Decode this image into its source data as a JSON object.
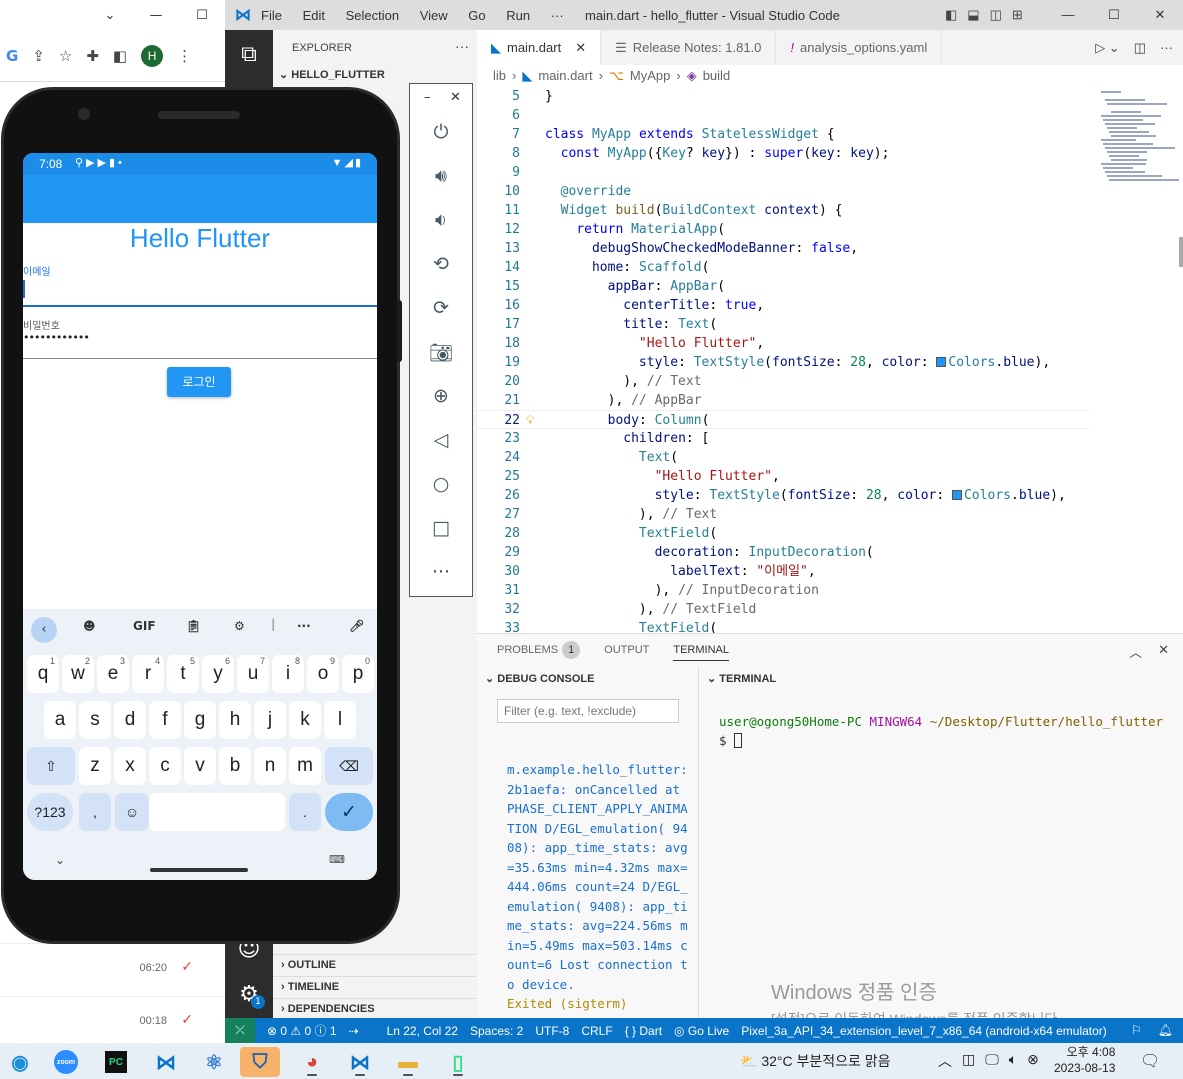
{
  "browser": {
    "window_controls": [
      "⌄",
      "—",
      "☐"
    ],
    "avatar_letter": "H",
    "chat_times": [
      "06:20",
      "00:18"
    ]
  },
  "vscode": {
    "title": "main.dart - hello_flutter - Visual Studio Code",
    "menu": [
      "File",
      "Edit",
      "Selection",
      "View",
      "Go",
      "Run",
      "···"
    ],
    "explorer_header": "EXPLORER",
    "project": "HELLO_FLUTTER",
    "sections": [
      "OUTLINE",
      "TIMELINE",
      "DEPENDENCIES"
    ],
    "tabs": [
      {
        "label": "main.dart",
        "icon": "dart-icon",
        "active": true
      },
      {
        "label": "Release Notes: 1.81.0",
        "icon": "notes-icon",
        "active": false
      },
      {
        "label": "analysis_options.yaml",
        "icon": "yaml-icon",
        "active": false
      }
    ],
    "breadcrumbs": [
      "lib",
      "main.dart",
      "MyApp",
      "build"
    ],
    "settings_badge": "1",
    "code_lines": [
      {
        "n": "5",
        "html": "}"
      },
      {
        "n": "6",
        "html": ""
      },
      {
        "n": "7",
        "html": "<span class='kw'>class</span> <span class='ty'>MyApp</span> <span class='kw'>extends</span> <span class='ty'>StatelessWidget</span> {"
      },
      {
        "n": "8",
        "html": "  <span class='kw'>const</span> <span class='ty'>MyApp</span>({<span class='ty'>Key</span>? <span class='pr'>key</span>}) : <span class='kw'>super</span>(<span class='pr'>key</span>: <span class='pr'>key</span>);"
      },
      {
        "n": "9",
        "html": ""
      },
      {
        "n": "10",
        "html": "  <span class='ty'>@override</span>"
      },
      {
        "n": "11",
        "html": "  <span class='ty'>Widget</span> <span class='fn'>build</span>(<span class='ty'>BuildContext</span> <span class='pr'>context</span>) {"
      },
      {
        "n": "12",
        "html": "    <span class='kw'>return</span> <span class='ty'>MaterialApp</span>("
      },
      {
        "n": "13",
        "html": "      <span class='pr'>debugShowCheckedModeBanner</span>: <span class='kw'>false</span>,"
      },
      {
        "n": "14",
        "html": "      <span class='pr'>home</span>: <span class='ty'>Scaffold</span>("
      },
      {
        "n": "15",
        "html": "        <span class='pr'>appBar</span>: <span class='ty'>AppBar</span>("
      },
      {
        "n": "16",
        "html": "          <span class='pr'>centerTitle</span>: <span class='kw'>true</span>,"
      },
      {
        "n": "17",
        "html": "          <span class='pr'>title</span>: <span class='ty'>Text</span>("
      },
      {
        "n": "18",
        "html": "            <span class='st'>\"Hello Flutter\"</span>,"
      },
      {
        "n": "19",
        "html": "            <span class='pr'>style</span>: <span class='ty'>TextStyle</span>(<span class='pr'>fontSize</span>: <span class='nm'>28</span>, <span class='pr'>color</span>: <span class='swatch'></span><span class='ty'>Colors</span>.<span class='pr'>blue</span>),"
      },
      {
        "n": "20",
        "html": "          ), <span class='cm'>// Text</span>"
      },
      {
        "n": "21",
        "html": "        ), <span class='cm'>// AppBar</span>"
      },
      {
        "n": "22",
        "html": "        <span class='pr'>body</span>: <span class='ty'>Column</span>(",
        "current": true
      },
      {
        "n": "23",
        "html": "          <span class='pr'>children</span>: ["
      },
      {
        "n": "24",
        "html": "            <span class='ty'>Text</span>("
      },
      {
        "n": "25",
        "html": "              <span class='st'>\"Hello Flutter\"</span>,"
      },
      {
        "n": "26",
        "html": "              <span class='pr'>style</span>: <span class='ty'>TextStyle</span>(<span class='pr'>fontSize</span>: <span class='nm'>28</span>, <span class='pr'>color</span>: <span class='swatch'></span><span class='ty'>Colors</span>.<span class='pr'>blue</span>),"
      },
      {
        "n": "27",
        "html": "            ), <span class='cm'>// Text</span>"
      },
      {
        "n": "28",
        "html": "            <span class='ty'>TextField</span>("
      },
      {
        "n": "29",
        "html": "              <span class='pr'>decoration</span>: <span class='ty'>InputDecoration</span>("
      },
      {
        "n": "30",
        "html": "                <span class='pr'>labelText</span>: <span class='st'>\"이메일\"</span>,"
      },
      {
        "n": "31",
        "html": "              ), <span class='cm'>// InputDecoration</span>"
      },
      {
        "n": "32",
        "html": "            ), <span class='cm'>// TextField</span>"
      },
      {
        "n": "33",
        "html": "            <span class='ty'>TextField</span>("
      }
    ],
    "panel": {
      "tabs": [
        "PROBLEMS",
        "OUTPUT",
        "TERMINAL"
      ],
      "problems_count": "1",
      "debug_console_title": "DEBUG CONSOLE",
      "filter_placeholder": "Filter (e.g. text, !exclude)",
      "log_text": "m.example.hello_flutter:2b1aefa: onCancelled at PHASE_CLIENT_APPLY_ANIMATION D/EGL_emulation( 9408): app_time_stats: avg=35.63ms min=4.32ms max=444.06ms count=24 D/EGL_emulation( 9408): app_time_stats: avg=224.56ms min=5.49ms max=503.14ms count=6 Lost connection to device.",
      "log_exit": "Exited (sigterm)",
      "terminal_title": "TERMINAL",
      "term_user": "user@ogong50Home-PC",
      "term_shell": "MINGW64",
      "term_path": "~/Desktop/Flutter/hello_flutter",
      "term_prompt": "$",
      "activation_title": "Windows 정품 인증",
      "activation_sub": "[설정]으로 이동하여 Windows를 정품 인증합니다."
    },
    "statusbar": {
      "errors": "⊗ 0 ⚠ 0 ⓘ 1",
      "position": "Ln 22, Col 22",
      "spaces": "Spaces: 2",
      "encoding": "UTF-8",
      "eol": "CRLF",
      "lang": "{ } Dart",
      "golive": "Go Live",
      "device": "Pixel_3a_API_34_extension_level_7_x86_64 (android-x64 emulator)"
    }
  },
  "phone": {
    "time": "7:08",
    "app_title": "Hello Flutter",
    "email_label": "이메일",
    "password_label": "비밀번호",
    "password_value": "••••••••••••",
    "login_button": "로그인",
    "keyboard": {
      "gif": "GIF",
      "row1": [
        [
          "q",
          "1"
        ],
        [
          "w",
          "2"
        ],
        [
          "e",
          "3"
        ],
        [
          "r",
          "4"
        ],
        [
          "t",
          "5"
        ],
        [
          "y",
          "6"
        ],
        [
          "u",
          "7"
        ],
        [
          "i",
          "8"
        ],
        [
          "o",
          "9"
        ],
        [
          "p",
          "0"
        ]
      ],
      "row2": [
        "a",
        "s",
        "d",
        "f",
        "g",
        "h",
        "j",
        "k",
        "l"
      ],
      "row3": [
        "z",
        "x",
        "c",
        "v",
        "b",
        "n",
        "m"
      ],
      "sym": "?123",
      "comma": ",",
      "period": "."
    }
  },
  "taskbar": {
    "weather": "32°C  부분적으로 맑음",
    "time": "오후 4:08",
    "date": "2023-08-13"
  }
}
